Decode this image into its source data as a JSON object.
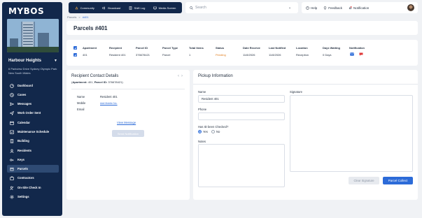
{
  "sidebar": {
    "logo": "MYBOS",
    "building_name": "Harbour Heights",
    "building_address": "6 Parkview Drive Sydney Olympic Park New South Wales",
    "items": [
      {
        "label": "Dashboard",
        "icon": "dashboard-icon"
      },
      {
        "label": "Cases",
        "icon": "cases-icon"
      },
      {
        "label": "Messages",
        "icon": "messages-icon"
      },
      {
        "label": "Work Order Sent",
        "icon": "work-order-icon"
      },
      {
        "label": "Calendar",
        "icon": "calendar-icon"
      },
      {
        "label": "Maintenance Schedule",
        "icon": "maintenance-icon"
      },
      {
        "label": "Building",
        "icon": "building-icon"
      },
      {
        "label": "Residents",
        "icon": "residents-icon"
      },
      {
        "label": "Keys",
        "icon": "keys-icon"
      },
      {
        "label": "Parcels",
        "icon": "parcels-icon",
        "active": true
      },
      {
        "label": "Contractors",
        "icon": "contractors-icon"
      },
      {
        "label": "On-Site Check In",
        "icon": "check-in-icon"
      },
      {
        "label": "Settings",
        "icon": "settings-icon"
      }
    ]
  },
  "topbar": {
    "tabs": [
      {
        "label": "Community",
        "icon": "community-icon"
      },
      {
        "label": "Broadcast",
        "icon": "broadcast-icon"
      },
      {
        "label": "Shift Log",
        "icon": "shift-log-icon"
      },
      {
        "label": "Media Screen",
        "icon": "media-screen-icon"
      }
    ],
    "search_placeholder": "Search",
    "help_label": "Help",
    "feedback_label": "Feedback",
    "notification_label": "Notification"
  },
  "breadcrumb": {
    "parent": "Parcels",
    "sep": ">",
    "current": "#401"
  },
  "page": {
    "title": "Parcels #401"
  },
  "table": {
    "headers": [
      "Apartment",
      "Recipient",
      "Parcel ID",
      "Parcel Type",
      "Total Items",
      "Status",
      "Date Receive",
      "Last Notified",
      "Location",
      "Days Waiting",
      "Notification"
    ],
    "row": [
      "401",
      "Resident 401",
      "376678421",
      "Parcel",
      "1",
      "Pending",
      "11/8/2026",
      "11/8/2026",
      "Reception",
      "0 Days"
    ],
    "status_color": "#e07b1a"
  },
  "contact": {
    "title": "Recipient Contact Details",
    "apartment_label": "Apartment:",
    "apartment_value": "401",
    "parcel_id_label": "Parcel ID:",
    "parcel_id_value": "376678421",
    "name_label": "Name",
    "name_value": "Resident 401",
    "mobile_label": "Mobile",
    "mobile_link": "Add Mobile No.",
    "email_label": "Email",
    "view_message": "View Message",
    "send_notification": "Send Notification"
  },
  "pickup": {
    "title": "Pickup Information",
    "name_label": "Name",
    "name_value": "Resident 401",
    "phone_label": "Phone",
    "phone_value": "",
    "id_checked_label": "Has ID been Checked?",
    "yes_label": "Yes",
    "no_label": "No",
    "id_checked_value": "Yes",
    "notes_label": "Notes",
    "signature_label": "Signature",
    "clear_signature": "Clear Signature",
    "parcel_collect": "Parcel Collect"
  },
  "colors": {
    "sidebar": "#12284b",
    "accent": "#2c6bd8",
    "pending": "#e07b1a",
    "background": "#f0f2f5"
  }
}
